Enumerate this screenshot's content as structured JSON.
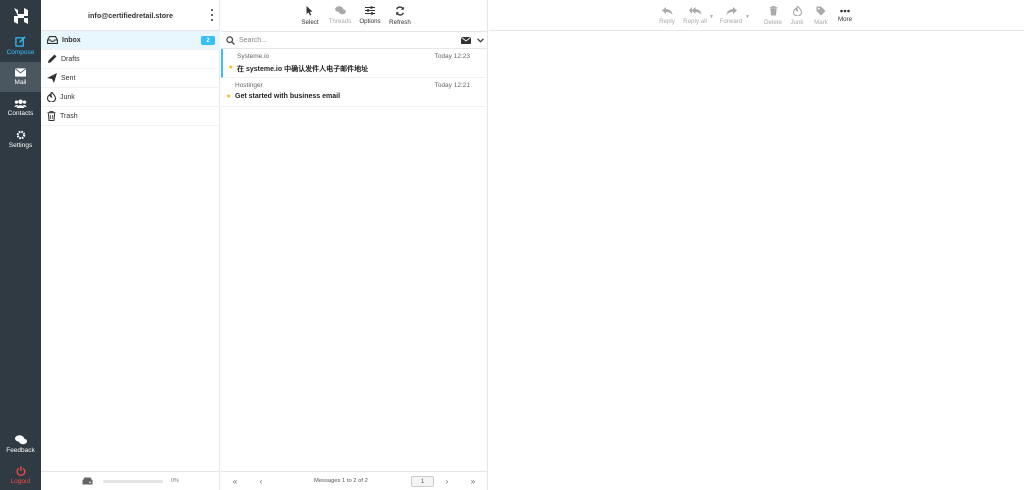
{
  "nav": {
    "compose": "Compose",
    "mail": "Mail",
    "contacts": "Contacts",
    "settings": "Settings",
    "feedback": "Feedback",
    "logout": "Logout"
  },
  "account": {
    "email": "info@certifiedretail.store"
  },
  "folders": [
    {
      "label": "Inbox",
      "unread": "2"
    },
    {
      "label": "Drafts"
    },
    {
      "label": "Sent"
    },
    {
      "label": "Junk"
    },
    {
      "label": "Trash"
    }
  ],
  "quota": {
    "percent_text": "0%",
    "fraction": 0.0
  },
  "list_toolbar": {
    "select": "Select",
    "threads": "Threads",
    "options": "Options",
    "refresh": "Refresh"
  },
  "search": {
    "placeholder": "Search..."
  },
  "messages": [
    {
      "from": "Systeme.io",
      "date": "Today 12:23",
      "subject": "在 systeme.io 中确认发件人电子邮件地址"
    },
    {
      "from": "Hostinger",
      "date": "Today 12:21",
      "subject": "Get started with business email"
    }
  ],
  "pager": {
    "count_text": "Messages 1 to 2 of 2",
    "page": "1"
  },
  "preview_toolbar": {
    "reply": "Reply",
    "reply_all": "Reply all",
    "forward": "Forward",
    "delete": "Delete",
    "junk": "Junk",
    "mark": "Mark",
    "more": "More"
  },
  "colors": {
    "nav_bg": "#2f3a42",
    "accent": "#37beff",
    "logout": "#f04a4a"
  }
}
